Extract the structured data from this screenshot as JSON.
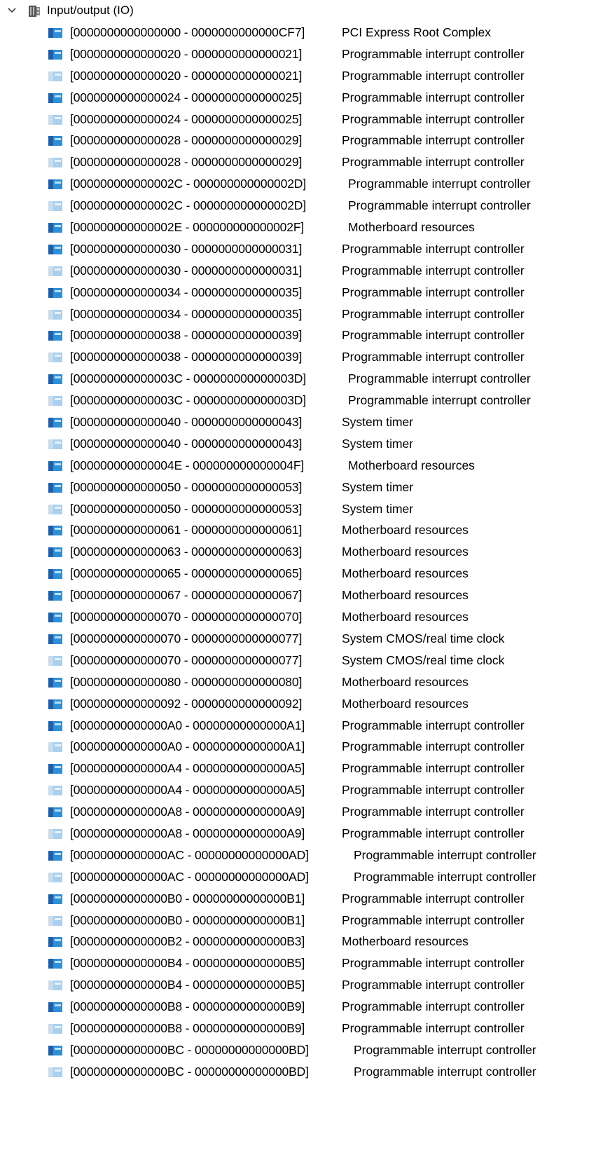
{
  "tree": {
    "root": {
      "label": "Input/output (IO)",
      "expanded": true,
      "icon": "io-device-icon"
    },
    "item_icon": "io-resource-icon",
    "items": [
      {
        "range": "[0000000000000000 - 0000000000000CF7]",
        "desc": "PCI Express Root Complex",
        "state": "active"
      },
      {
        "range": "[0000000000000020 - 0000000000000021]",
        "desc": "Programmable interrupt controller",
        "state": "active"
      },
      {
        "range": "[0000000000000020 - 0000000000000021]",
        "desc": "Programmable interrupt controller",
        "state": "faded"
      },
      {
        "range": "[0000000000000024 - 0000000000000025]",
        "desc": "Programmable interrupt controller",
        "state": "active"
      },
      {
        "range": "[0000000000000024 - 0000000000000025]",
        "desc": "Programmable interrupt controller",
        "state": "faded"
      },
      {
        "range": "[0000000000000028 - 0000000000000029]",
        "desc": "Programmable interrupt controller",
        "state": "active"
      },
      {
        "range": "[0000000000000028 - 0000000000000029]",
        "desc": "Programmable interrupt controller",
        "state": "faded"
      },
      {
        "range": "[000000000000002C - 000000000000002D]",
        "desc": "Programmable interrupt controller",
        "state": "active"
      },
      {
        "range": "[000000000000002C - 000000000000002D]",
        "desc": "Programmable interrupt controller",
        "state": "faded"
      },
      {
        "range": "[000000000000002E - 000000000000002F]",
        "desc": "Motherboard resources",
        "state": "active"
      },
      {
        "range": "[0000000000000030 - 0000000000000031]",
        "desc": "Programmable interrupt controller",
        "state": "active"
      },
      {
        "range": "[0000000000000030 - 0000000000000031]",
        "desc": "Programmable interrupt controller",
        "state": "faded"
      },
      {
        "range": "[0000000000000034 - 0000000000000035]",
        "desc": "Programmable interrupt controller",
        "state": "active"
      },
      {
        "range": "[0000000000000034 - 0000000000000035]",
        "desc": "Programmable interrupt controller",
        "state": "faded"
      },
      {
        "range": "[0000000000000038 - 0000000000000039]",
        "desc": "Programmable interrupt controller",
        "state": "active"
      },
      {
        "range": "[0000000000000038 - 0000000000000039]",
        "desc": "Programmable interrupt controller",
        "state": "faded"
      },
      {
        "range": "[000000000000003C - 000000000000003D]",
        "desc": "Programmable interrupt controller",
        "state": "active"
      },
      {
        "range": "[000000000000003C - 000000000000003D]",
        "desc": "Programmable interrupt controller",
        "state": "faded"
      },
      {
        "range": "[0000000000000040 - 0000000000000043]",
        "desc": "System timer",
        "state": "active"
      },
      {
        "range": "[0000000000000040 - 0000000000000043]",
        "desc": "System timer",
        "state": "faded"
      },
      {
        "range": "[000000000000004E - 000000000000004F]",
        "desc": "Motherboard resources",
        "state": "active"
      },
      {
        "range": "[0000000000000050 - 0000000000000053]",
        "desc": "System timer",
        "state": "active"
      },
      {
        "range": "[0000000000000050 - 0000000000000053]",
        "desc": "System timer",
        "state": "faded"
      },
      {
        "range": "[0000000000000061 - 0000000000000061]",
        "desc": "Motherboard resources",
        "state": "active"
      },
      {
        "range": "[0000000000000063 - 0000000000000063]",
        "desc": "Motherboard resources",
        "state": "active"
      },
      {
        "range": "[0000000000000065 - 0000000000000065]",
        "desc": "Motherboard resources",
        "state": "active"
      },
      {
        "range": "[0000000000000067 - 0000000000000067]",
        "desc": "Motherboard resources",
        "state": "active"
      },
      {
        "range": "[0000000000000070 - 0000000000000070]",
        "desc": "Motherboard resources",
        "state": "active"
      },
      {
        "range": "[0000000000000070 - 0000000000000077]",
        "desc": "System CMOS/real time clock",
        "state": "active"
      },
      {
        "range": "[0000000000000070 - 0000000000000077]",
        "desc": "System CMOS/real time clock",
        "state": "faded"
      },
      {
        "range": "[0000000000000080 - 0000000000000080]",
        "desc": "Motherboard resources",
        "state": "active"
      },
      {
        "range": "[0000000000000092 - 0000000000000092]",
        "desc": "Motherboard resources",
        "state": "active"
      },
      {
        "range": "[00000000000000A0 - 00000000000000A1]",
        "desc": "Programmable interrupt controller",
        "state": "active"
      },
      {
        "range": "[00000000000000A0 - 00000000000000A1]",
        "desc": "Programmable interrupt controller",
        "state": "faded"
      },
      {
        "range": "[00000000000000A4 - 00000000000000A5]",
        "desc": "Programmable interrupt controller",
        "state": "active"
      },
      {
        "range": "[00000000000000A4 - 00000000000000A5]",
        "desc": "Programmable interrupt controller",
        "state": "faded"
      },
      {
        "range": "[00000000000000A8 - 00000000000000A9]",
        "desc": "Programmable interrupt controller",
        "state": "active"
      },
      {
        "range": "[00000000000000A8 - 00000000000000A9]",
        "desc": "Programmable interrupt controller",
        "state": "faded"
      },
      {
        "range": "[00000000000000AC - 00000000000000AD]",
        "desc": "Programmable interrupt controller",
        "state": "active"
      },
      {
        "range": "[00000000000000AC - 00000000000000AD]",
        "desc": "Programmable interrupt controller",
        "state": "faded"
      },
      {
        "range": "[00000000000000B0 - 00000000000000B1]",
        "desc": "Programmable interrupt controller",
        "state": "active"
      },
      {
        "range": "[00000000000000B0 - 00000000000000B1]",
        "desc": "Programmable interrupt controller",
        "state": "faded"
      },
      {
        "range": "[00000000000000B2 - 00000000000000B3]",
        "desc": "Motherboard resources",
        "state": "active"
      },
      {
        "range": "[00000000000000B4 - 00000000000000B5]",
        "desc": "Programmable interrupt controller",
        "state": "active"
      },
      {
        "range": "[00000000000000B4 - 00000000000000B5]",
        "desc": "Programmable interrupt controller",
        "state": "faded"
      },
      {
        "range": "[00000000000000B8 - 00000000000000B9]",
        "desc": "Programmable interrupt controller",
        "state": "active"
      },
      {
        "range": "[00000000000000B8 - 00000000000000B9]",
        "desc": "Programmable interrupt controller",
        "state": "faded"
      },
      {
        "range": "[00000000000000BC - 00000000000000BD]",
        "desc": "Programmable interrupt controller",
        "state": "active"
      },
      {
        "range": "[00000000000000BC - 00000000000000BD]",
        "desc": "Programmable interrupt controller",
        "state": "faded"
      }
    ]
  },
  "colors": {
    "icon_active_blue": "#2e8fd6",
    "icon_active_dark": "#1f5fa8",
    "icon_faded_blue": "#a9d0ee",
    "icon_faded_dark": "#c9dcec",
    "chevron": "#404040"
  }
}
